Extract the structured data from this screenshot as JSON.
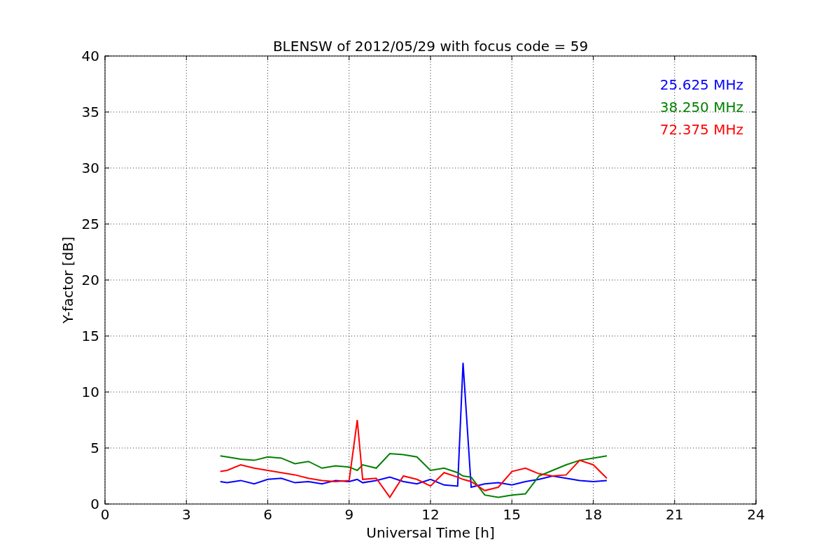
{
  "chart_data": {
    "type": "line",
    "title": "BLENSW of 2012/05/29 with focus code = 59",
    "xlabel": "Universal Time [h]",
    "ylabel": "Y-factor [dB]",
    "x": [
      4.25,
      4.5,
      5,
      5.5,
      6,
      6.5,
      7,
      7.5,
      8,
      8.5,
      9,
      9.3,
      9.5,
      10,
      10.5,
      11,
      11.5,
      12,
      12.5,
      13,
      13.2,
      13.5,
      14,
      14.5,
      15,
      15.5,
      16,
      16.5,
      17,
      17.5,
      18,
      18.5
    ],
    "series": [
      {
        "name": "25.625 MHz",
        "color": "#0000ff",
        "values": [
          2.0,
          1.9,
          2.1,
          1.8,
          2.2,
          2.3,
          1.9,
          2.0,
          1.8,
          2.1,
          2.0,
          2.2,
          1.9,
          2.1,
          2.4,
          2.0,
          1.8,
          2.2,
          1.7,
          1.6,
          12.6,
          1.5,
          1.8,
          1.9,
          1.7,
          2.0,
          2.2,
          2.5,
          2.3,
          2.1,
          2.0,
          2.1
        ]
      },
      {
        "name": "38.250 MHz",
        "color": "#008000",
        "values": [
          4.3,
          4.2,
          4.0,
          3.9,
          4.2,
          4.1,
          3.6,
          3.8,
          3.2,
          3.4,
          3.3,
          3.0,
          3.5,
          3.2,
          4.5,
          4.4,
          4.2,
          3.0,
          3.2,
          2.8,
          2.5,
          2.4,
          0.8,
          0.6,
          0.8,
          0.9,
          2.5,
          3.0,
          3.5,
          3.9,
          4.1,
          4.3
        ]
      },
      {
        "name": "72.375 MHz",
        "color": "#ff0000",
        "values": [
          2.9,
          3.0,
          3.5,
          3.2,
          3.0,
          2.8,
          2.6,
          2.3,
          2.1,
          2.0,
          2.1,
          7.5,
          2.2,
          2.3,
          0.6,
          2.5,
          2.2,
          1.6,
          2.8,
          2.4,
          2.2,
          2.0,
          1.2,
          1.5,
          2.9,
          3.2,
          2.7,
          2.5,
          2.6,
          3.9,
          3.5,
          2.3
        ]
      }
    ],
    "grid": true,
    "xlim": [
      0,
      24
    ],
    "ylim": [
      0,
      40
    ],
    "xticks": [
      0,
      3,
      6,
      9,
      12,
      15,
      18,
      21,
      24
    ],
    "yticks": [
      0,
      5,
      10,
      15,
      20,
      25,
      30,
      35,
      40
    ]
  }
}
